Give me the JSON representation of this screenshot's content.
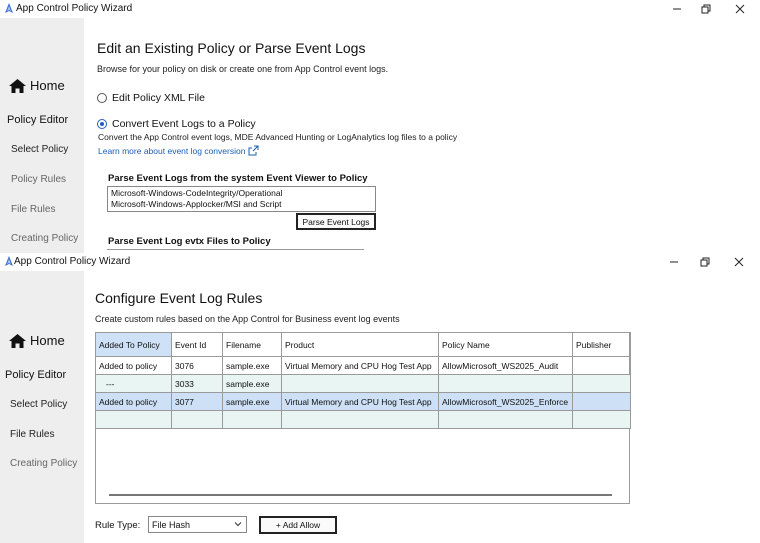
{
  "window_top": {
    "title": "App Control Policy Wizard",
    "sidebar": {
      "home": "Home",
      "policy_editor": "Policy Editor",
      "select_policy": "Select Policy",
      "policy_rules": "Policy Rules",
      "file_rules": "File Rules",
      "creating_policy": "Creating Policy"
    },
    "main": {
      "heading": "Edit an Existing Policy or Parse Event Logs",
      "subheading": "Browse for your policy on disk or create one from App Control event logs.",
      "option_edit_xml": "Edit Policy XML File",
      "option_convert": "Convert Event Logs to a Policy",
      "convert_description": "Convert the App Control event logs, MDE Advanced Hunting or LogAnalytics log files to a policy",
      "learn_more_link": "Learn more about event log conversion",
      "parse_viewer_title": "Parse Event Logs from the system Event Viewer to Policy",
      "event_logs": [
        "Microsoft-Windows-CodeIntegrity/Operational",
        "Microsoft-Windows-Applocker/MSI and Script"
      ],
      "parse_button": "Parse Event Logs",
      "parse_evtx_title": "Parse Event Log evtx Files to Policy"
    }
  },
  "window_bottom": {
    "title": "App Control Policy Wizard",
    "sidebar": {
      "home": "Home",
      "policy_editor": "Policy Editor",
      "select_policy": "Select Policy",
      "file_rules": "File Rules",
      "creating_policy": "Creating Policy"
    },
    "main": {
      "heading": "Configure Event Log Rules",
      "subheading": "Create custom rules based on the App Control for Business event log events",
      "table": {
        "columns": [
          "Added To Policy",
          "Event Id",
          "Filename",
          "Product",
          "Policy Name",
          "Publisher"
        ],
        "rows": [
          [
            "Added to policy",
            "3076",
            "sample.exe",
            "Virtual Memory and CPU Hog Test App",
            "AllowMicrosoft_WS2025_Audit",
            ""
          ],
          [
            "---",
            "3033",
            "sample.exe",
            "",
            "",
            ""
          ],
          [
            "Added to policy",
            "3077",
            "sample.exe",
            "Virtual Memory and CPU Hog Test App",
            "AllowMicrosoft_WS2025_Enforce",
            ""
          ],
          [
            "",
            "",
            "",
            "",
            "",
            ""
          ]
        ]
      },
      "rule_type_label": "Rule Type:",
      "rule_type_value": "File Hash",
      "add_allow_button": "+ Add Allow"
    }
  },
  "colors": {
    "accent": "#1f5fbf",
    "link": "#1a5fb4",
    "sidebar_bg": "#eeeeee",
    "selected_row": "#cde0f6",
    "alt_row": "#e9f5f2"
  },
  "icons": {
    "app": "app-control-wizard-icon",
    "home": "home-icon",
    "external_link": "external-link-icon",
    "minimize": "minimize-icon",
    "maximize": "restore-icon",
    "close": "close-icon",
    "dropdown": "chevron-down-icon"
  }
}
